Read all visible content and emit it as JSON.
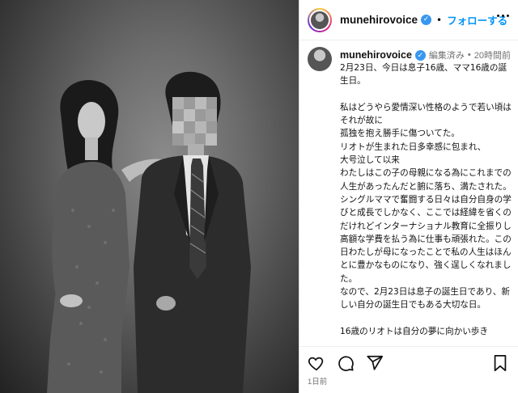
{
  "post": {
    "username": "munehirovoice",
    "follow_label": "フォローする",
    "header_separator": "•"
  },
  "caption": {
    "username": "munehirovoice",
    "edited_label": "編集済み",
    "separator": "•",
    "time_ago": "20時間前",
    "paragraphs": [
      "2月23日、今日は息子16歳、ママ16歳の誕生日。",
      "",
      "私はどうやら愛情深い性格のようで若い頃はそれが故に",
      "孤独を抱え勝手に傷ついてた。",
      "リオトが生まれた日多幸感に包まれ、",
      "大号泣して以来",
      "わたしはこの子の母親になる為にこれまでの人生があったんだと腑に落ち、満たされた。",
      "シングルママで奮闘する日々は自分自身の学びと成長でしかなく、ここでは経緯を省くのだけれどインターナショナル教育に全振りし高額な学費を払う為に仕事も頑張れた。この日わたしが母になったことで私の人生はほんとに豊かなものになり、強く逞しくなれました。",
      "なので、2月23日は息子の誕生日であり、新しい自分の誕生日でもある大切な日。",
      "",
      "16歳のリオトは自分の夢に向かい歩き"
    ]
  },
  "actions": {
    "like_icon": "heart-icon",
    "comment_icon": "comment-icon",
    "share_icon": "share-icon",
    "save_icon": "bookmark-icon"
  },
  "timestamp": "1日前",
  "colors": {
    "link_blue": "#0095f6",
    "verified_blue": "#3897f0",
    "meta_gray": "#737373"
  }
}
